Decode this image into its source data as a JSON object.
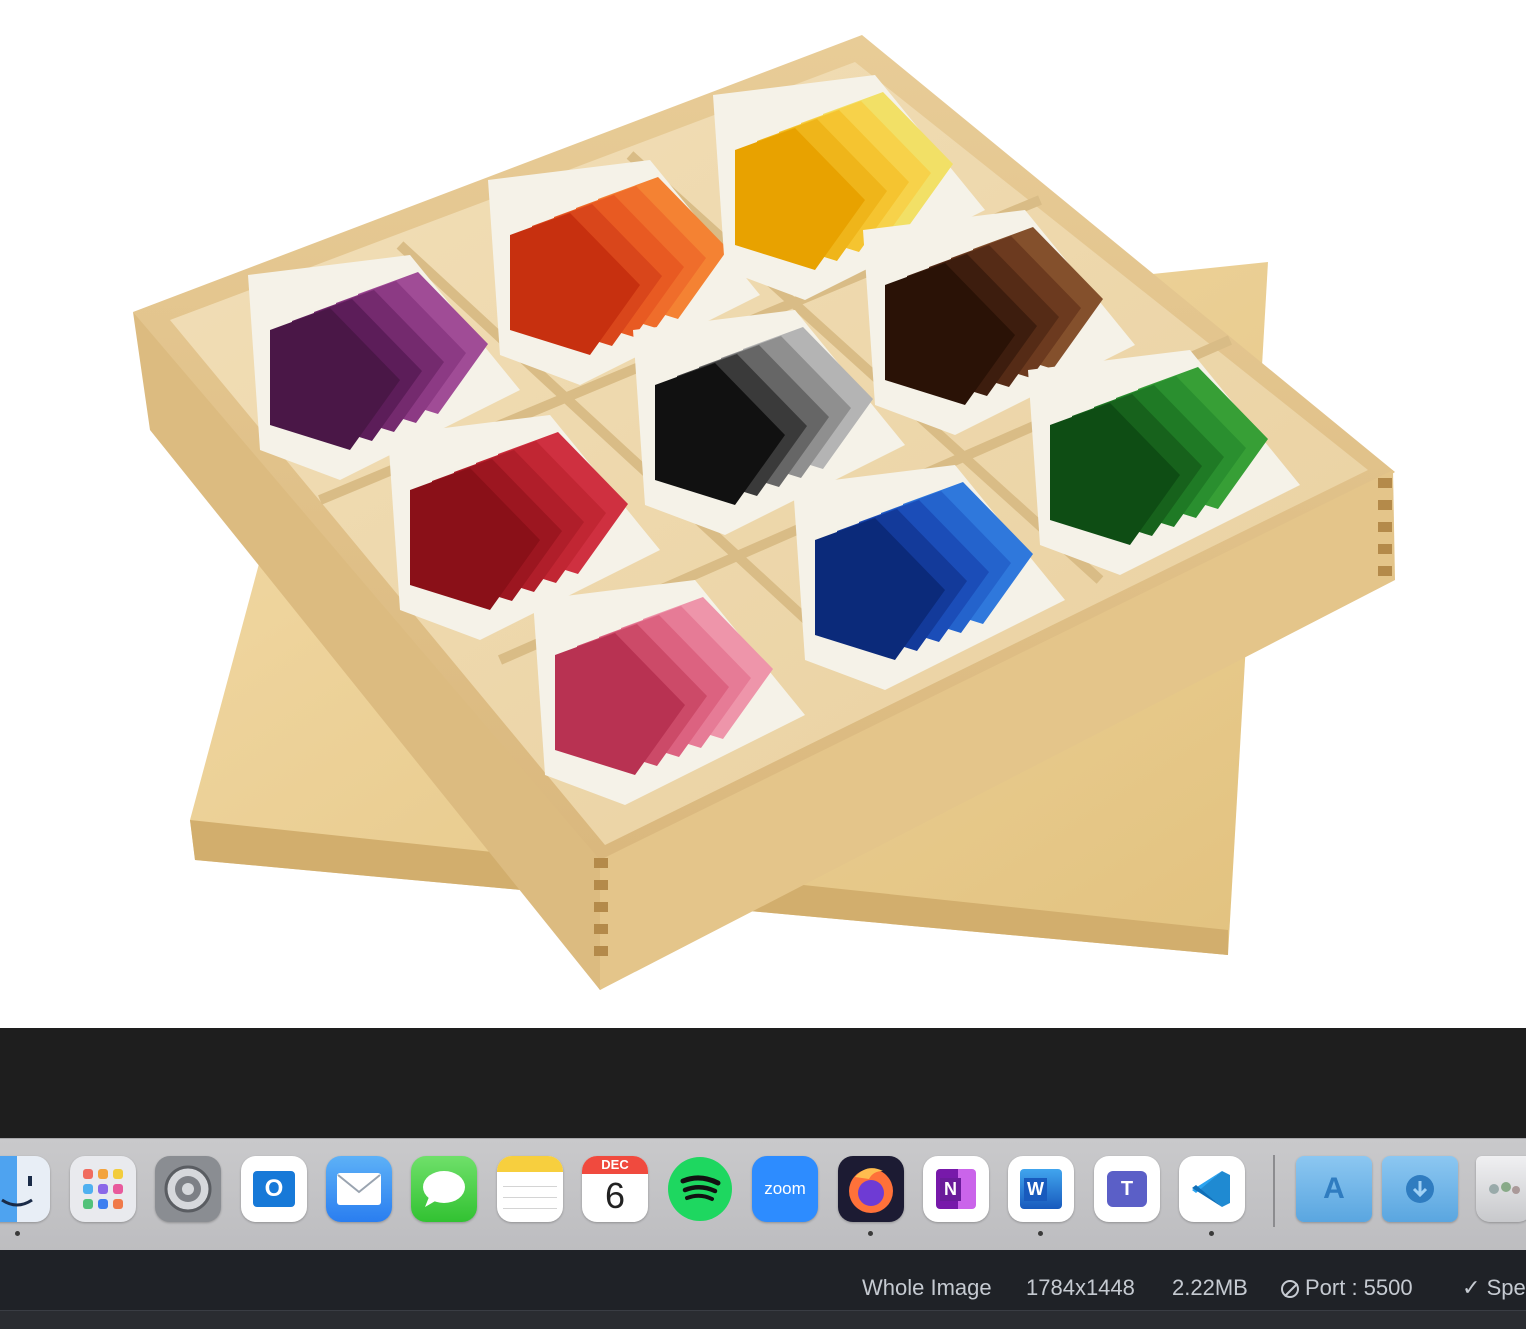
{
  "viewer": {
    "image_subject": "wooden-box-with-color-tablets"
  },
  "dock": {
    "apps": [
      {
        "name": "Finder",
        "icon": "finder-icon",
        "running": true
      },
      {
        "name": "Launchpad",
        "icon": "launchpad-icon",
        "running": false
      },
      {
        "name": "System Settings",
        "icon": "settings-gear-icon",
        "running": false
      },
      {
        "name": "Outlook",
        "icon": "outlook-icon",
        "running": false,
        "glyph": "O"
      },
      {
        "name": "Mail",
        "icon": "mail-icon",
        "running": false
      },
      {
        "name": "Messages",
        "icon": "messages-icon",
        "running": false
      },
      {
        "name": "Notes",
        "icon": "notes-icon",
        "running": false
      },
      {
        "name": "Calendar",
        "icon": "calendar-icon",
        "running": false,
        "month": "DEC",
        "day": "6"
      },
      {
        "name": "Spotify",
        "icon": "spotify-icon",
        "running": false
      },
      {
        "name": "Zoom",
        "icon": "zoom-icon",
        "running": false,
        "label": "zoom"
      },
      {
        "name": "Firefox",
        "icon": "firefox-icon",
        "running": true
      },
      {
        "name": "OneNote",
        "icon": "onenote-icon",
        "running": false,
        "glyph": "N"
      },
      {
        "name": "Word",
        "icon": "word-icon",
        "running": true,
        "glyph": "W"
      },
      {
        "name": "Teams",
        "icon": "teams-icon",
        "running": false,
        "glyph": "T"
      },
      {
        "name": "Visual Studio Code",
        "icon": "vscode-icon",
        "running": true
      }
    ],
    "folders": [
      {
        "name": "Applications",
        "icon": "applications-folder-icon",
        "glyph": "A"
      },
      {
        "name": "Downloads",
        "icon": "downloads-folder-icon"
      }
    ],
    "trash": {
      "name": "Trash",
      "icon": "trash-icon"
    }
  },
  "status_bar": {
    "mode": "Whole Image",
    "dimensions": "1784x1448",
    "file_size": "2.22MB",
    "port": "Port : 5500",
    "spell": "Spe"
  },
  "colors": {
    "dock_bg": "#c4c4c6",
    "status_bg": "#1f2227",
    "band_bg": "#1e1e1e",
    "wood": "#e3c48f"
  }
}
